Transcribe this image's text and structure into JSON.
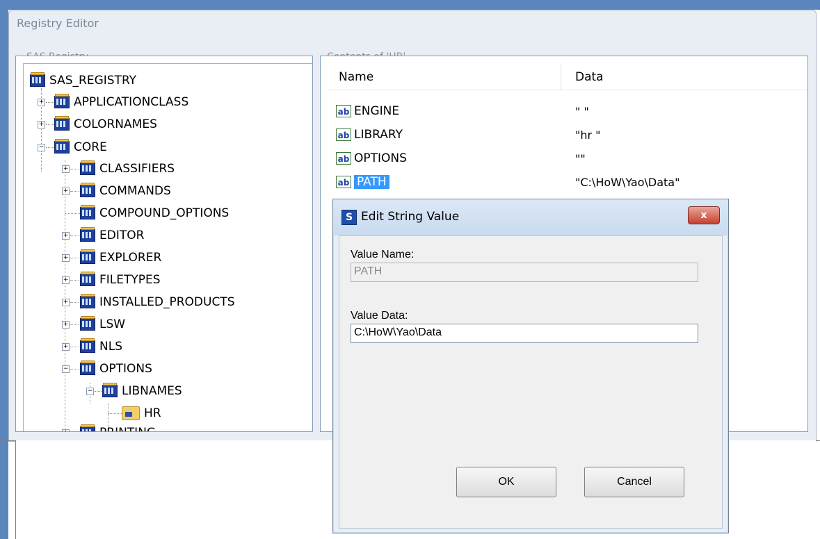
{
  "window": {
    "title": "Registry Editor"
  },
  "tree": {
    "label": "SAS Registry",
    "items": [
      {
        "label": "SAS_REGISTRY"
      },
      {
        "label": "APPLICATIONCLASS"
      },
      {
        "label": "COLORNAMES"
      },
      {
        "label": "CORE"
      },
      {
        "label": "CLASSIFIERS"
      },
      {
        "label": "COMMANDS"
      },
      {
        "label": "COMPOUND_OPTIONS"
      },
      {
        "label": "EDITOR"
      },
      {
        "label": "EXPLORER"
      },
      {
        "label": "FILETYPES"
      },
      {
        "label": "INSTALLED_PRODUCTS"
      },
      {
        "label": "LSW"
      },
      {
        "label": "NLS"
      },
      {
        "label": "OPTIONS"
      },
      {
        "label": "LIBNAMES"
      },
      {
        "label": "HR"
      },
      {
        "label": "PRINTING"
      }
    ]
  },
  "contents": {
    "label": "Contents of 'HR'",
    "columns": {
      "name": "Name",
      "data": "Data"
    },
    "rows": [
      {
        "name": "ENGINE",
        "data": "\"       \""
      },
      {
        "name": "LIBRARY",
        "data": "\"hr      \""
      },
      {
        "name": "OPTIONS",
        "data": "\"\""
      },
      {
        "name": "PATH",
        "data": "\"C:\\HoW\\Yao\\Data\""
      }
    ]
  },
  "dialog": {
    "title": "Edit String Value",
    "close_label": "x",
    "value_name_label": "Value Name:",
    "value_name": "PATH",
    "value_data_label": "Value Data:",
    "value_data": "C:\\HoW\\Yao\\Data",
    "ok_label": "OK",
    "cancel_label": "Cancel"
  },
  "icons": {
    "registry_key": "registry-key-icon",
    "folder": "folder-icon",
    "string_value": "ab-string-icon",
    "app": "sas-app-icon"
  },
  "colors": {
    "selection": "#3399ff",
    "window_bg": "#e9eef5",
    "close_button": "#c7402f"
  }
}
